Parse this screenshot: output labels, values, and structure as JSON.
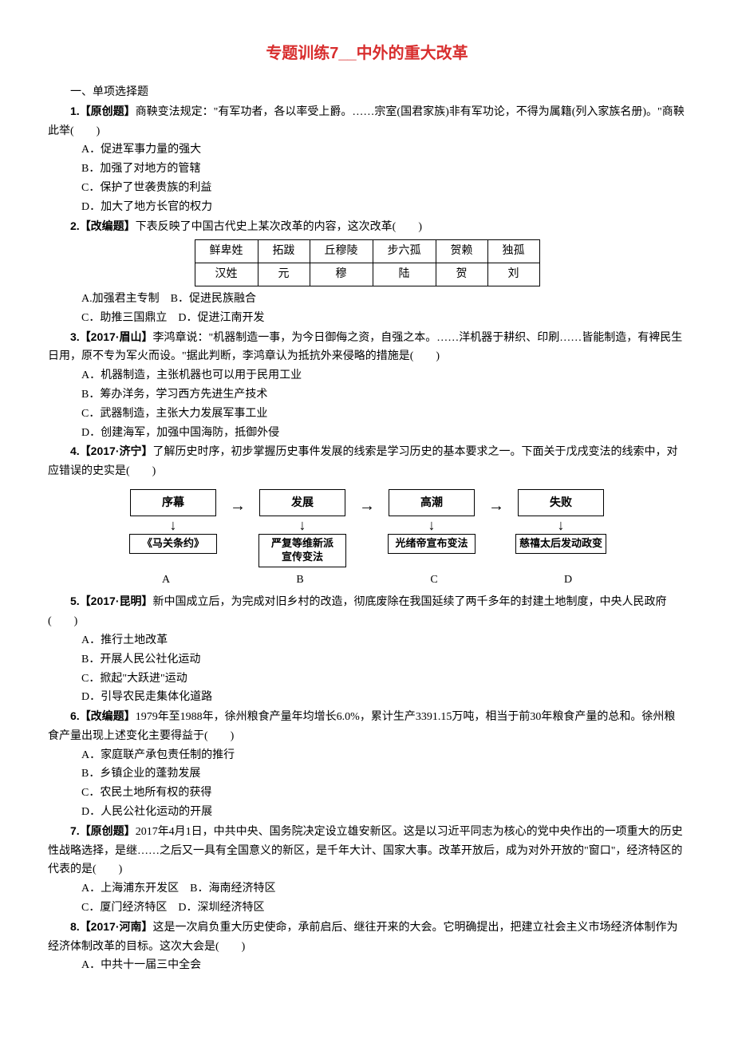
{
  "title": "专题训练7__中外的重大改革",
  "section1": "一、单项选择题",
  "q1": {
    "num": "1.",
    "tag": "【原创题】",
    "text": "商鞅变法规定：\"有军功者，各以率受上爵。……宗室(国君家族)非有军功论，不得为属籍(列入家族名册)。\"商鞅此举(　　)",
    "A": "A．促进军事力量的强大",
    "B": "B．加强了对地方的管辖",
    "C": "C．保护了世袭贵族的利益",
    "D": "D．加大了地方长官的权力"
  },
  "q2": {
    "num": "2.",
    "tag": "【改编题】",
    "text": "下表反映了中国古代史上某次改革的内容，这次改革(　　)",
    "table": {
      "r1c1": "鲜卑姓",
      "r1c2": "拓跋",
      "r1c3": "丘穆陵",
      "r1c4": "步六孤",
      "r1c5": "贺赖",
      "r1c6": "独孤",
      "r2c1": "汉姓",
      "r2c2": "元",
      "r2c3": "穆",
      "r2c4": "陆",
      "r2c5": "贺",
      "r2c6": "刘"
    },
    "AB": "A.加强君主专制　B．促进民族融合",
    "CD": "C．助推三国鼎立　D．促进江南开发"
  },
  "q3": {
    "num": "3.",
    "tag": "【2017·眉山】",
    "text": "李鸿章说：\"机器制造一事，为今日御侮之资，自强之本。……洋机器于耕织、印刷……皆能制造，有裨民生日用，原不专为军火而设。\"据此判断，李鸿章认为抵抗外来侵略的措施是(　　)",
    "A": "A．机器制造，主张机器也可以用于民用工业",
    "B": "B．筹办洋务，学习西方先进生产技术",
    "C": "C．武器制造，主张大力发展军事工业",
    "D": "D．创建海军，加强中国海防，抵御外侵"
  },
  "q4": {
    "num": "4.",
    "tag": "【2017·济宁】",
    "text": "了解历史时序，初步掌握历史事件发展的线索是学习历史的基本要求之一。下面关于戊戌变法的线索中，对应错误的史实是(　　)",
    "flow": {
      "top1": "序幕",
      "top2": "发展",
      "top3": "高潮",
      "top4": "失败",
      "bot1": "《马关条约》",
      "bot2": "严复等维新派\n宣传变法",
      "bot3": "光绪帝宣布变法",
      "bot4": "慈禧太后发动政变",
      "labA": "A",
      "labB": "B",
      "labC": "C",
      "labD": "D"
    }
  },
  "q5": {
    "num": "5.",
    "tag": "【2017·昆明】",
    "text": "新中国成立后，为完成对旧乡村的改造，彻底废除在我国延续了两千多年的封建土地制度，中央人民政府(　　)",
    "A": "A．推行土地改革",
    "B": "B．开展人民公社化运动",
    "C": "C．掀起\"大跃进\"运动",
    "D": "D．引导农民走集体化道路"
  },
  "q6": {
    "num": "6.",
    "tag": "【改编题】",
    "text": "1979年至1988年，徐州粮食产量年均增长6.0%，累计生产3391.15万吨，相当于前30年粮食产量的总和。徐州粮食产量出现上述变化主要得益于(　　)",
    "A": "A．家庭联产承包责任制的推行",
    "B": "B．乡镇企业的蓬勃发展",
    "C": "C．农民土地所有权的获得",
    "D": "D．人民公社化运动的开展"
  },
  "q7": {
    "num": "7.",
    "tag": "【原创题】",
    "text": "2017年4月1日，中共中央、国务院决定设立雄安新区。这是以习近平同志为核心的党中央作出的一项重大的历史性战略选择，是继……之后又一具有全国意义的新区，是千年大计、国家大事。改革开放后，成为对外开放的\"窗口\"，经济特区的代表的是(　　)",
    "AB": "A．上海浦东开发区　B．海南经济特区",
    "CD": "C．厦门经济特区　D．深圳经济特区"
  },
  "q8": {
    "num": "8.",
    "tag": "【2017·河南】",
    "text": "这是一次肩负重大历史使命，承前启后、继往开来的大会。它明确提出，把建立社会主义市场经济体制作为经济体制改革的目标。这次大会是(　　)",
    "A": "A．中共十一届三中全会"
  }
}
